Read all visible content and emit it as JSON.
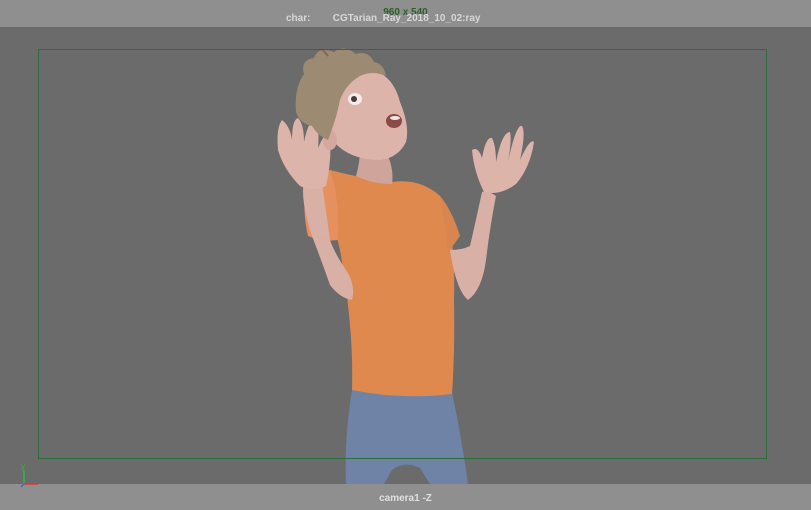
{
  "viewport": {
    "resolution": "960 x 540",
    "hud_key": "char:",
    "hud_value": "CGTarian_Ray_2018_10_02:ray",
    "camera": "camera1 -Z"
  },
  "axis": {
    "y_label": "y"
  },
  "colors": {
    "background": "#6b6b6b",
    "gate_band": "#8f8f8f",
    "film_gate": "#2e6b3a",
    "shirt": "#e0894f",
    "pants": "#6e83a6",
    "skin": "#d9b0a6",
    "hair": "#9c8a73"
  }
}
